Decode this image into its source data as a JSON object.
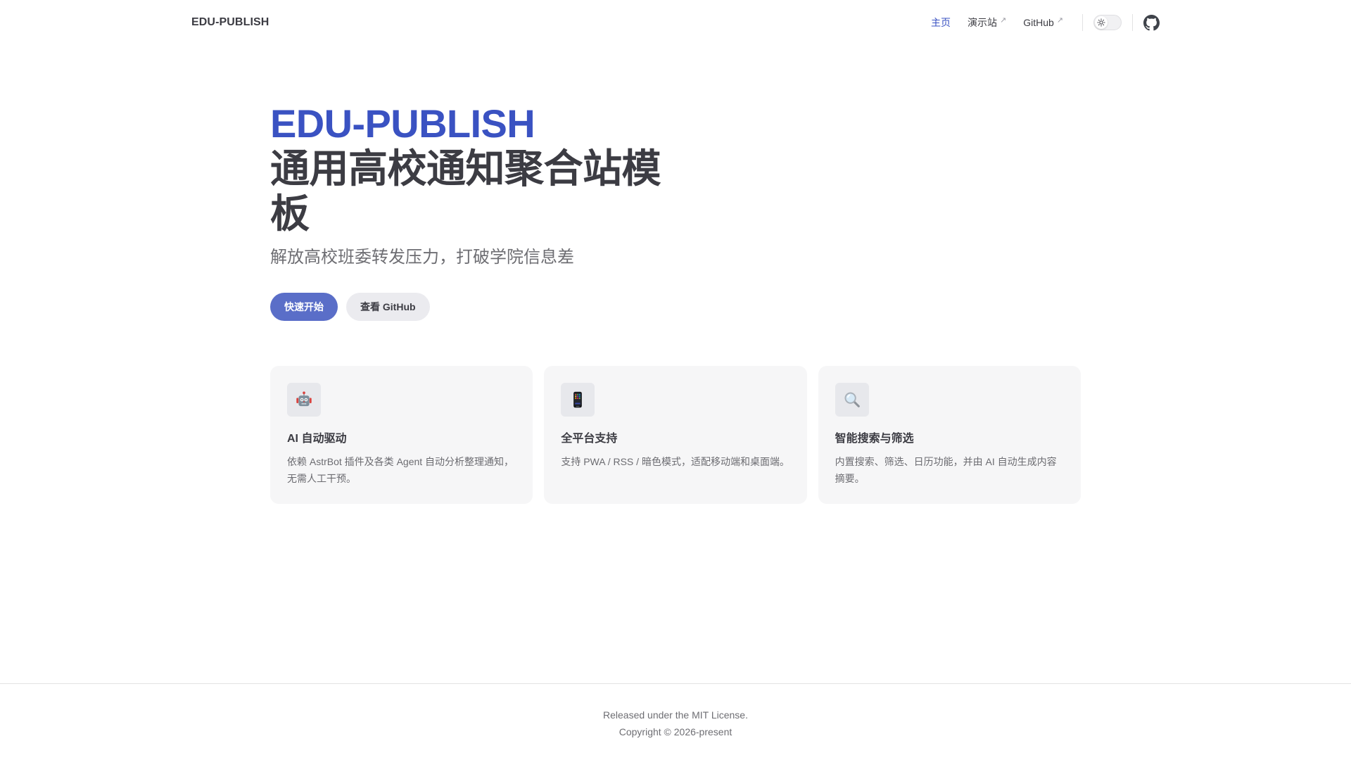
{
  "colors": {
    "brand_text": "#3a52c2",
    "brand_button": "#5a6ec8",
    "alt_button_bg": "#ebebef",
    "card_bg": "#f6f6f7",
    "text_secondary": "#67676c"
  },
  "navbar": {
    "logo": "EDU-PUBLISH",
    "links": [
      {
        "label": "主页",
        "active": true,
        "external": false
      },
      {
        "label": "演示站",
        "active": false,
        "external": true
      },
      {
        "label": "GitHub",
        "active": false,
        "external": true
      }
    ],
    "external_arrow": "↗",
    "theme_toggle": {
      "state": "light",
      "icon": "sun-icon"
    },
    "social_icon": "github-icon"
  },
  "hero": {
    "name": "EDU-PUBLISH",
    "heading": "通用高校通知聚合站模板",
    "tagline": "解放高校班委转发压力，打破学院信息差",
    "actions": [
      {
        "label": "快速开始",
        "style": "brand"
      },
      {
        "label": "查看 GitHub",
        "style": "alt"
      }
    ]
  },
  "features": [
    {
      "icon": "robot-icon",
      "title": "AI 自动驱动",
      "description": "依赖 AstrBot 插件及各类 Agent 自动分析整理通知，无需人工干预。"
    },
    {
      "icon": "mobile-phone-icon",
      "title": "全平台支持",
      "description": "支持 PWA / RSS / 暗色模式，适配移动端和桌面端。"
    },
    {
      "icon": "magnifier-icon",
      "title": "智能搜索与筛选",
      "description": "内置搜索、筛选、日历功能，并由 AI 自动生成内容摘要。"
    }
  ],
  "footer": {
    "message": "Released under the MIT License.",
    "copyright": "Copyright © 2026-present"
  }
}
